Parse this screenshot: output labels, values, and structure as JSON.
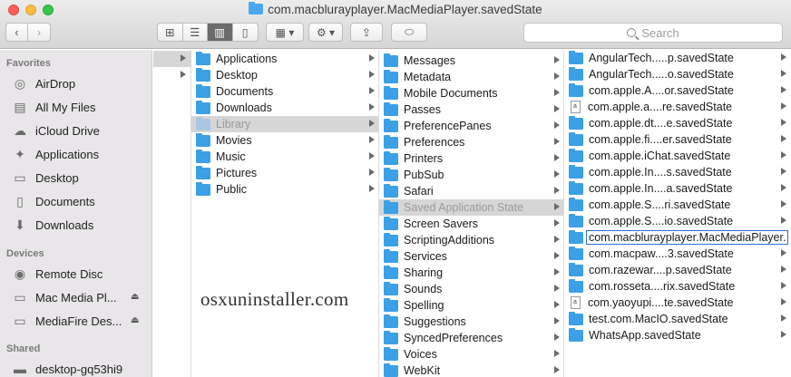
{
  "window": {
    "title": "com.macblurayplayer.MacMediaPlayer.savedState"
  },
  "toolbar": {
    "back_icon": "chevron-left-icon",
    "forward_icon": "chevron-right-icon",
    "view_modes": [
      {
        "name": "icon-view-icon",
        "glyph": "⊞"
      },
      {
        "name": "list-view-icon",
        "glyph": "☰"
      },
      {
        "name": "column-view-icon",
        "glyph": "▥"
      },
      {
        "name": "cover-flow-icon",
        "glyph": "▯"
      }
    ],
    "arrange_glyph": "▦ ▾",
    "action_glyph": "⚙ ▾",
    "share_glyph": "⇪",
    "tag_glyph": "⬭",
    "search_placeholder": "Search"
  },
  "sidebar": {
    "favorites_header": "Favorites",
    "favorites": [
      {
        "label": "AirDrop",
        "icon": "airdrop-icon",
        "glyph": "◎"
      },
      {
        "label": "All My Files",
        "icon": "all-files-icon",
        "glyph": "▤"
      },
      {
        "label": "iCloud Drive",
        "icon": "cloud-icon",
        "glyph": "☁"
      },
      {
        "label": "Applications",
        "icon": "applications-icon",
        "glyph": "✦"
      },
      {
        "label": "Desktop",
        "icon": "desktop-icon",
        "glyph": "▭"
      },
      {
        "label": "Documents",
        "icon": "documents-icon",
        "glyph": "▯"
      },
      {
        "label": "Downloads",
        "icon": "downloads-icon",
        "glyph": "⬇"
      }
    ],
    "devices_header": "Devices",
    "devices": [
      {
        "label": "Remote Disc",
        "icon": "disc-icon",
        "glyph": "◉",
        "eject": false
      },
      {
        "label": "Mac Media Pl...",
        "icon": "drive-icon",
        "glyph": "▭",
        "eject": true
      },
      {
        "label": "MediaFire Des...",
        "icon": "drive-icon",
        "glyph": "▭",
        "eject": true
      }
    ],
    "shared_header": "Shared",
    "shared": [
      {
        "label": "desktop-gq53hi9",
        "icon": "computer-icon",
        "glyph": "▬"
      }
    ],
    "eject_glyph": "⏏"
  },
  "columns": [
    {
      "items": [
        {
          "label": "Applications",
          "icon": "applications-folder-icon",
          "state": "normal"
        },
        {
          "label": "Desktop",
          "icon": "desktop-folder-icon",
          "state": "normal"
        },
        {
          "label": "Documents",
          "icon": "documents-folder-icon",
          "state": "normal"
        },
        {
          "label": "Downloads",
          "icon": "downloads-folder-icon",
          "state": "normal"
        },
        {
          "label": "Library",
          "icon": "library-folder-icon",
          "state": "path"
        },
        {
          "label": "Movies",
          "icon": "movies-folder-icon",
          "state": "normal"
        },
        {
          "label": "Music",
          "icon": "music-folder-icon",
          "state": "normal"
        },
        {
          "label": "Pictures",
          "icon": "pictures-folder-icon",
          "state": "normal"
        },
        {
          "label": "Public",
          "icon": "public-folder-icon",
          "state": "normal"
        }
      ]
    },
    {
      "items": [
        {
          "label": "Messages",
          "state": "normal"
        },
        {
          "label": "Metadata",
          "state": "normal"
        },
        {
          "label": "Mobile Documents",
          "state": "normal"
        },
        {
          "label": "Passes",
          "state": "normal"
        },
        {
          "label": "PreferencePanes",
          "state": "normal"
        },
        {
          "label": "Preferences",
          "state": "normal"
        },
        {
          "label": "Printers",
          "state": "normal"
        },
        {
          "label": "PubSub",
          "state": "normal"
        },
        {
          "label": "Safari",
          "state": "normal"
        },
        {
          "label": "Saved Application State",
          "state": "path"
        },
        {
          "label": "Screen Savers",
          "state": "normal"
        },
        {
          "label": "ScriptingAdditions",
          "state": "normal"
        },
        {
          "label": "Services",
          "state": "normal"
        },
        {
          "label": "Sharing",
          "state": "normal"
        },
        {
          "label": "Sounds",
          "state": "normal"
        },
        {
          "label": "Spelling",
          "state": "normal"
        },
        {
          "label": "Suggestions",
          "state": "normal"
        },
        {
          "label": "SyncedPreferences",
          "state": "normal"
        },
        {
          "label": "Voices",
          "state": "normal"
        },
        {
          "label": "WebKit",
          "state": "normal"
        }
      ]
    },
    {
      "items": [
        {
          "label": "AngularTech.....p.savedState",
          "type": "folder",
          "state": "normal"
        },
        {
          "label": "AngularTech.....o.savedState",
          "type": "folder",
          "state": "normal"
        },
        {
          "label": "com.apple.A....or.savedState",
          "type": "folder",
          "state": "normal"
        },
        {
          "label": "com.apple.a....re.savedState",
          "type": "file",
          "state": "normal"
        },
        {
          "label": "com.apple.dt....e.savedState",
          "type": "folder",
          "state": "normal"
        },
        {
          "label": "com.apple.fi....er.savedState",
          "type": "folder",
          "state": "normal"
        },
        {
          "label": "com.apple.iChat.savedState",
          "type": "folder",
          "state": "normal"
        },
        {
          "label": "com.apple.In....s.savedState",
          "type": "folder",
          "state": "normal"
        },
        {
          "label": "com.apple.In....a.savedState",
          "type": "folder",
          "state": "normal"
        },
        {
          "label": "com.apple.S....ri.savedState",
          "type": "folder",
          "state": "normal"
        },
        {
          "label": "com.apple.S....io.savedState",
          "type": "folder",
          "state": "normal"
        },
        {
          "label": "com.macblurayplayer.MacMediaPlayer.",
          "type": "folder",
          "state": "selected"
        },
        {
          "label": "com.macpaw....3.savedState",
          "type": "folder",
          "state": "normal"
        },
        {
          "label": "com.razewar....p.savedState",
          "type": "folder",
          "state": "normal"
        },
        {
          "label": "com.rosseta....rix.savedState",
          "type": "folder",
          "state": "normal"
        },
        {
          "label": "com.yaoyupi....te.savedState",
          "type": "file",
          "state": "normal"
        },
        {
          "label": "test.com.MacIO.savedState",
          "type": "folder",
          "state": "normal"
        },
        {
          "label": "WhatsApp.savedState",
          "type": "folder",
          "state": "normal"
        }
      ]
    }
  ],
  "watermark": "osxuninstaller.com"
}
